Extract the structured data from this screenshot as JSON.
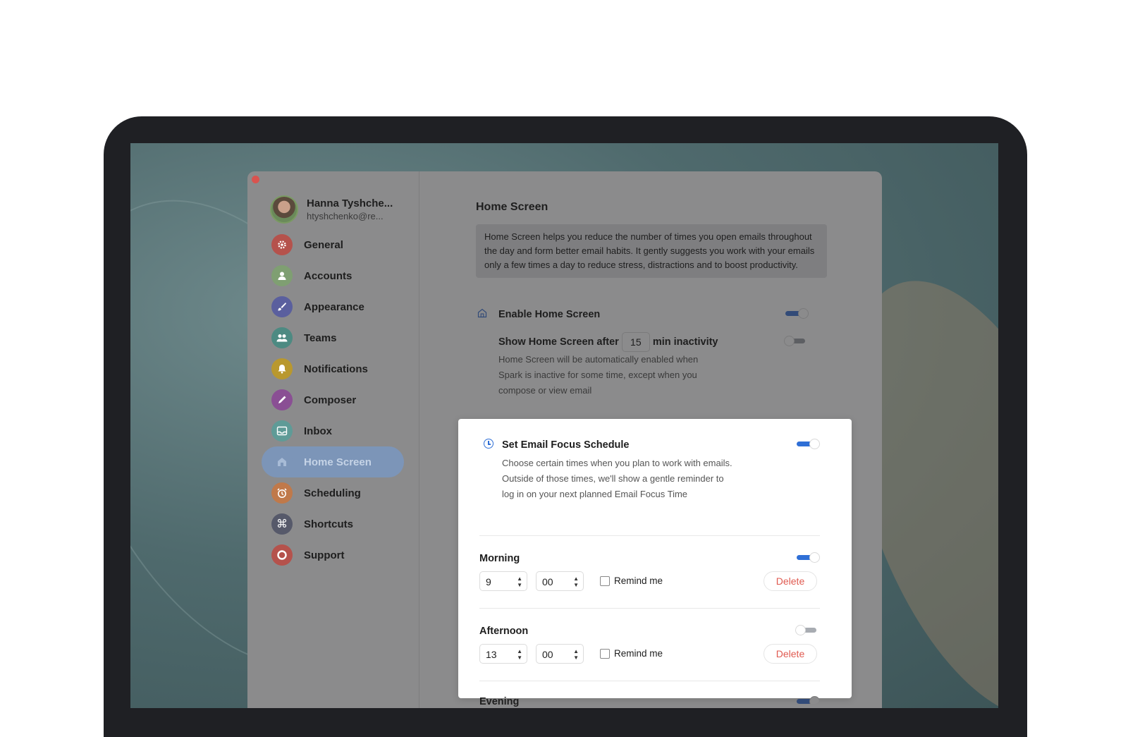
{
  "profile": {
    "name": "Hanna Tyshche...",
    "email": "htyshchenko@re..."
  },
  "nav": [
    {
      "label": "General",
      "icon": "gear-icon",
      "color": "#b5524c"
    },
    {
      "label": "Accounts",
      "icon": "person-icon",
      "color": "#7f9f72"
    },
    {
      "label": "Appearance",
      "icon": "brush-icon",
      "color": "#5a5f9e"
    },
    {
      "label": "Teams",
      "icon": "people-icon",
      "color": "#4d8a82"
    },
    {
      "label": "Notifications",
      "icon": "bell-icon",
      "color": "#b9982e"
    },
    {
      "label": "Composer",
      "icon": "pen-icon",
      "color": "#8a4f94"
    },
    {
      "label": "Inbox",
      "icon": "inbox-icon",
      "color": "#5f9b97"
    },
    {
      "label": "Home Screen",
      "icon": "house-icon",
      "color": "#7c95b8"
    },
    {
      "label": "Scheduling",
      "icon": "alarm-clock-icon",
      "color": "#c0794a"
    },
    {
      "label": "Shortcuts",
      "icon": "command-icon",
      "color": "#56596a"
    },
    {
      "label": "Support",
      "icon": "lifebuoy-icon",
      "color": "#b5524c"
    }
  ],
  "active_nav": "Home Screen",
  "home_screen": {
    "title": "Home Screen",
    "info": "Home Screen helps you reduce the number of times you open emails throughout the day and form better email habits. It gently suggests you work with your emails only a few times a day to reduce stress, distractions and to boost productivity.",
    "enable_label": "Enable Home Screen",
    "enable_on": true,
    "show_after_prefix": "Show Home Screen after",
    "show_after_value": "15",
    "show_after_suffix": "min inactivity",
    "show_after_on": false,
    "show_after_desc": "Home Screen will be automatically enabled when Spark is inactive for some time, except when you compose or view email"
  },
  "focus": {
    "title": "Set Email Focus Schedule",
    "on": true,
    "desc": "Choose certain times when you plan to work with emails. Outside of those times, we'll show a gentle reminder to log in on your next planned Email Focus Time",
    "remind_label": "Remind me",
    "delete_label": "Delete",
    "slots": [
      {
        "name": "Morning",
        "on": true,
        "hour": "9",
        "minute": "00",
        "remind": false
      },
      {
        "name": "Afternoon",
        "on": false,
        "hour": "13",
        "minute": "00",
        "remind": false
      },
      {
        "name": "Evening",
        "on": true
      }
    ]
  }
}
